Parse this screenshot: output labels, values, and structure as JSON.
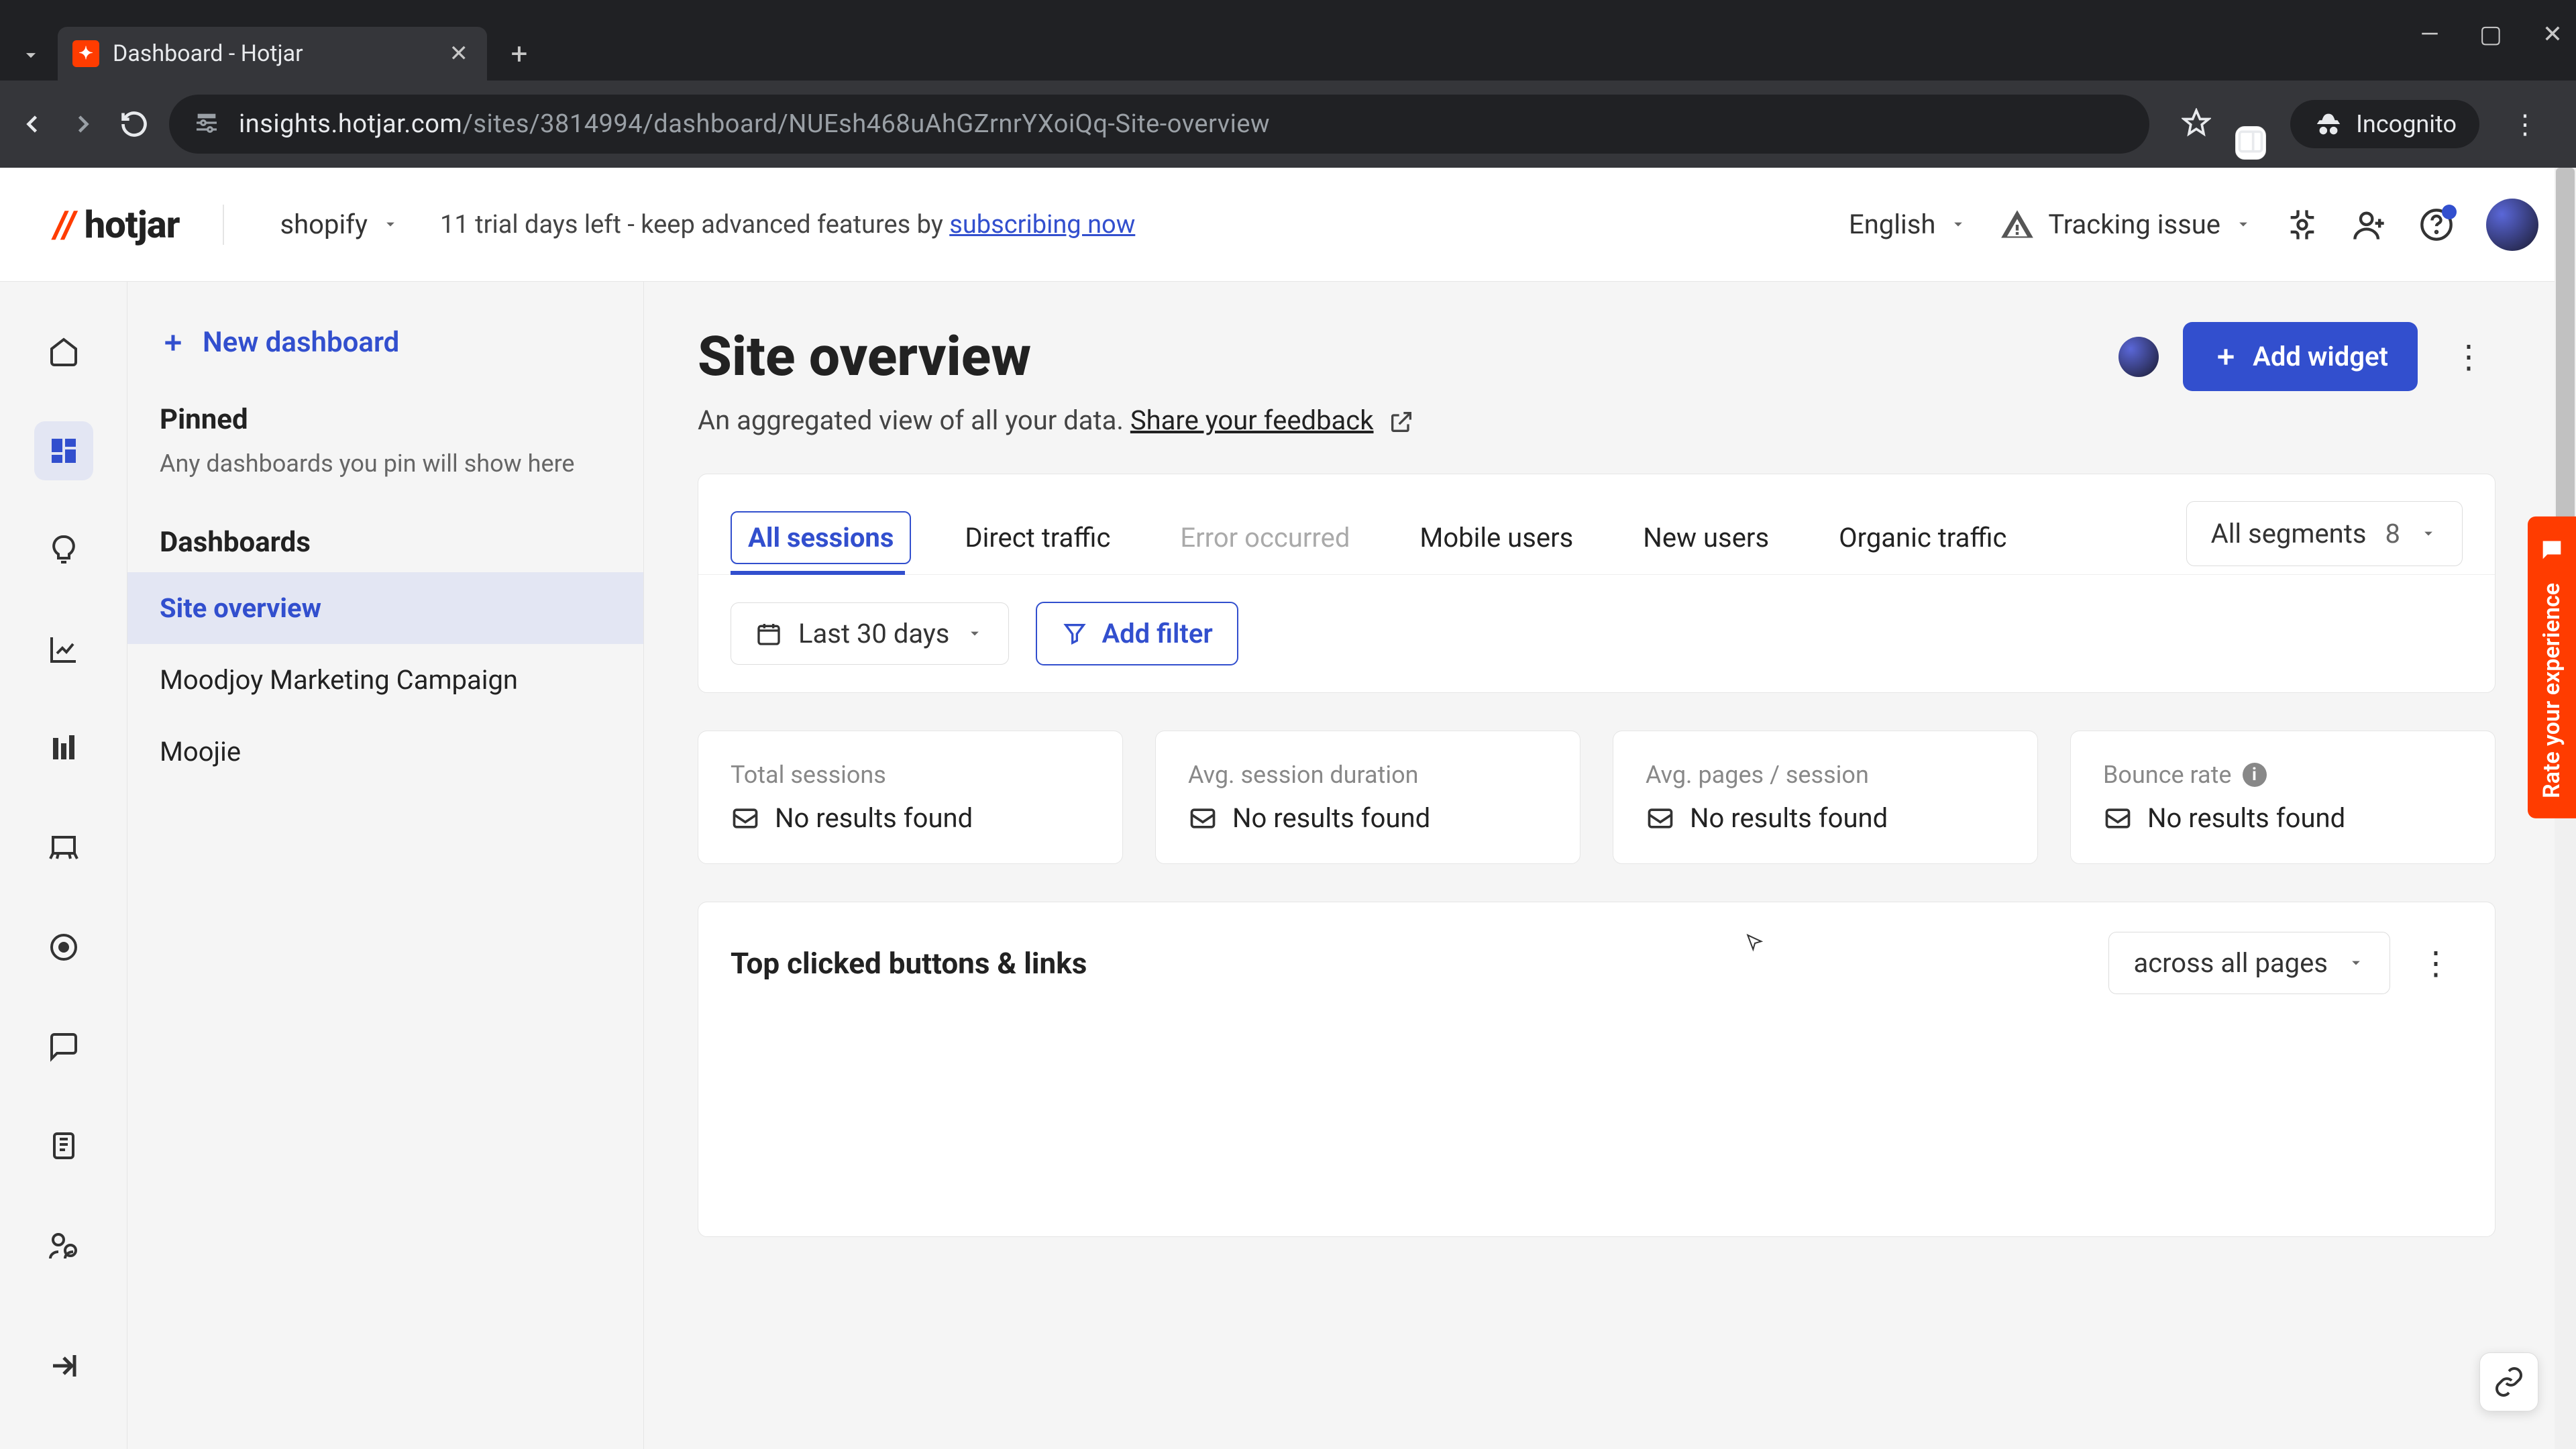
{
  "browser": {
    "tab_title": "Dashboard - Hotjar",
    "url_host": "insights.hotjar.com",
    "url_path": "/sites/3814994/dashboard/NUEsh468uAhGZrnrYXoiQq-Site-overview",
    "incognito_label": "Incognito"
  },
  "topbar": {
    "brand": "hotjar",
    "site_name": "shopify",
    "trial_prefix": "11 trial days left - keep advanced features by ",
    "trial_link": "subscribing now",
    "language": "English",
    "tracking_label": "Tracking issue"
  },
  "sidebar": {
    "new_dashboard": "New dashboard",
    "pinned_heading": "Pinned",
    "pinned_empty": "Any dashboards you pin will show here",
    "dashboards_heading": "Dashboards",
    "items": [
      {
        "label": "Site overview"
      },
      {
        "label": "Moodjoy Marketing Campaign"
      },
      {
        "label": "Moojie"
      }
    ]
  },
  "main": {
    "title": "Site overview",
    "subtitle_text": "An aggregated view of all your data. ",
    "subtitle_link": "Share your feedback",
    "add_widget": "Add widget",
    "segments": [
      {
        "label": "All sessions",
        "state": "active"
      },
      {
        "label": "Direct traffic",
        "state": "normal"
      },
      {
        "label": "Error occurred",
        "state": "disabled"
      },
      {
        "label": "Mobile users",
        "state": "normal"
      },
      {
        "label": "New users",
        "state": "normal"
      },
      {
        "label": "Organic traffic",
        "state": "normal"
      }
    ],
    "all_segments_label": "All segments",
    "all_segments_count": "8",
    "date_label": "Last 30 days",
    "add_filter": "Add filter",
    "metrics": [
      {
        "title": "Total sessions",
        "value": "No results found"
      },
      {
        "title": "Avg. session duration",
        "value": "No results found"
      },
      {
        "title": "Avg. pages / session",
        "value": "No results found"
      },
      {
        "title": "Bounce rate",
        "value": "No results found",
        "info": true
      }
    ],
    "widget_title": "Top clicked buttons & links",
    "widget_scope": "across all pages"
  },
  "misc": {
    "rate_label": "Rate your experience"
  }
}
